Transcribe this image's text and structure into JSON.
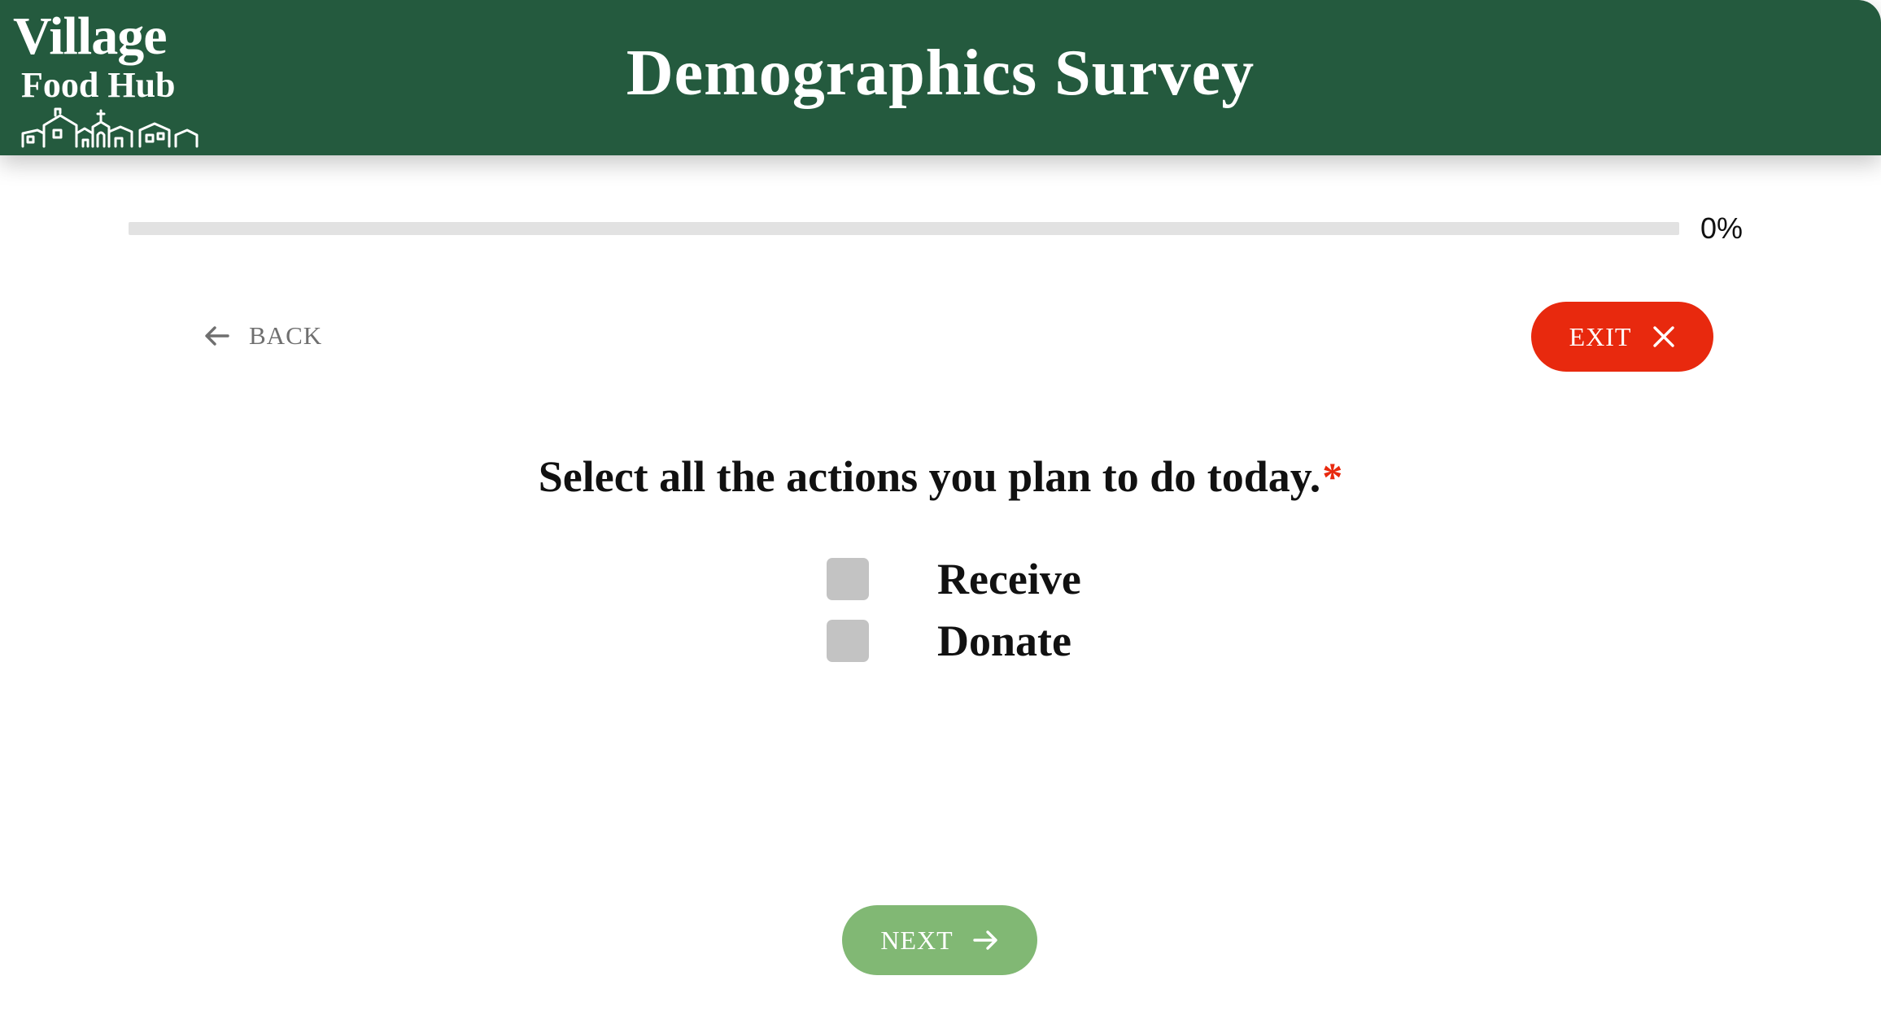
{
  "header": {
    "logo": {
      "line1": "Village",
      "line2": "Food Hub"
    },
    "title": "Demographics Survey"
  },
  "progress": {
    "value_percent": 0,
    "label": "0%"
  },
  "navigation": {
    "back_label": "BACK",
    "back_icon": "arrow-left-icon",
    "exit_label": "EXIT",
    "exit_icon": "close-icon",
    "next_label": "NEXT",
    "next_icon": "arrow-right-icon"
  },
  "question": {
    "text": "Select all the actions you plan to do today.",
    "required_marker": "*",
    "options": [
      {
        "label": "Receive",
        "checked": false
      },
      {
        "label": "Donate",
        "checked": false
      }
    ]
  },
  "colors": {
    "header_bg": "#245a3e",
    "exit_bg": "#e8290e",
    "next_bg": "#81b874",
    "required": "#e8290e",
    "checkbox": "#c3c3c3"
  }
}
